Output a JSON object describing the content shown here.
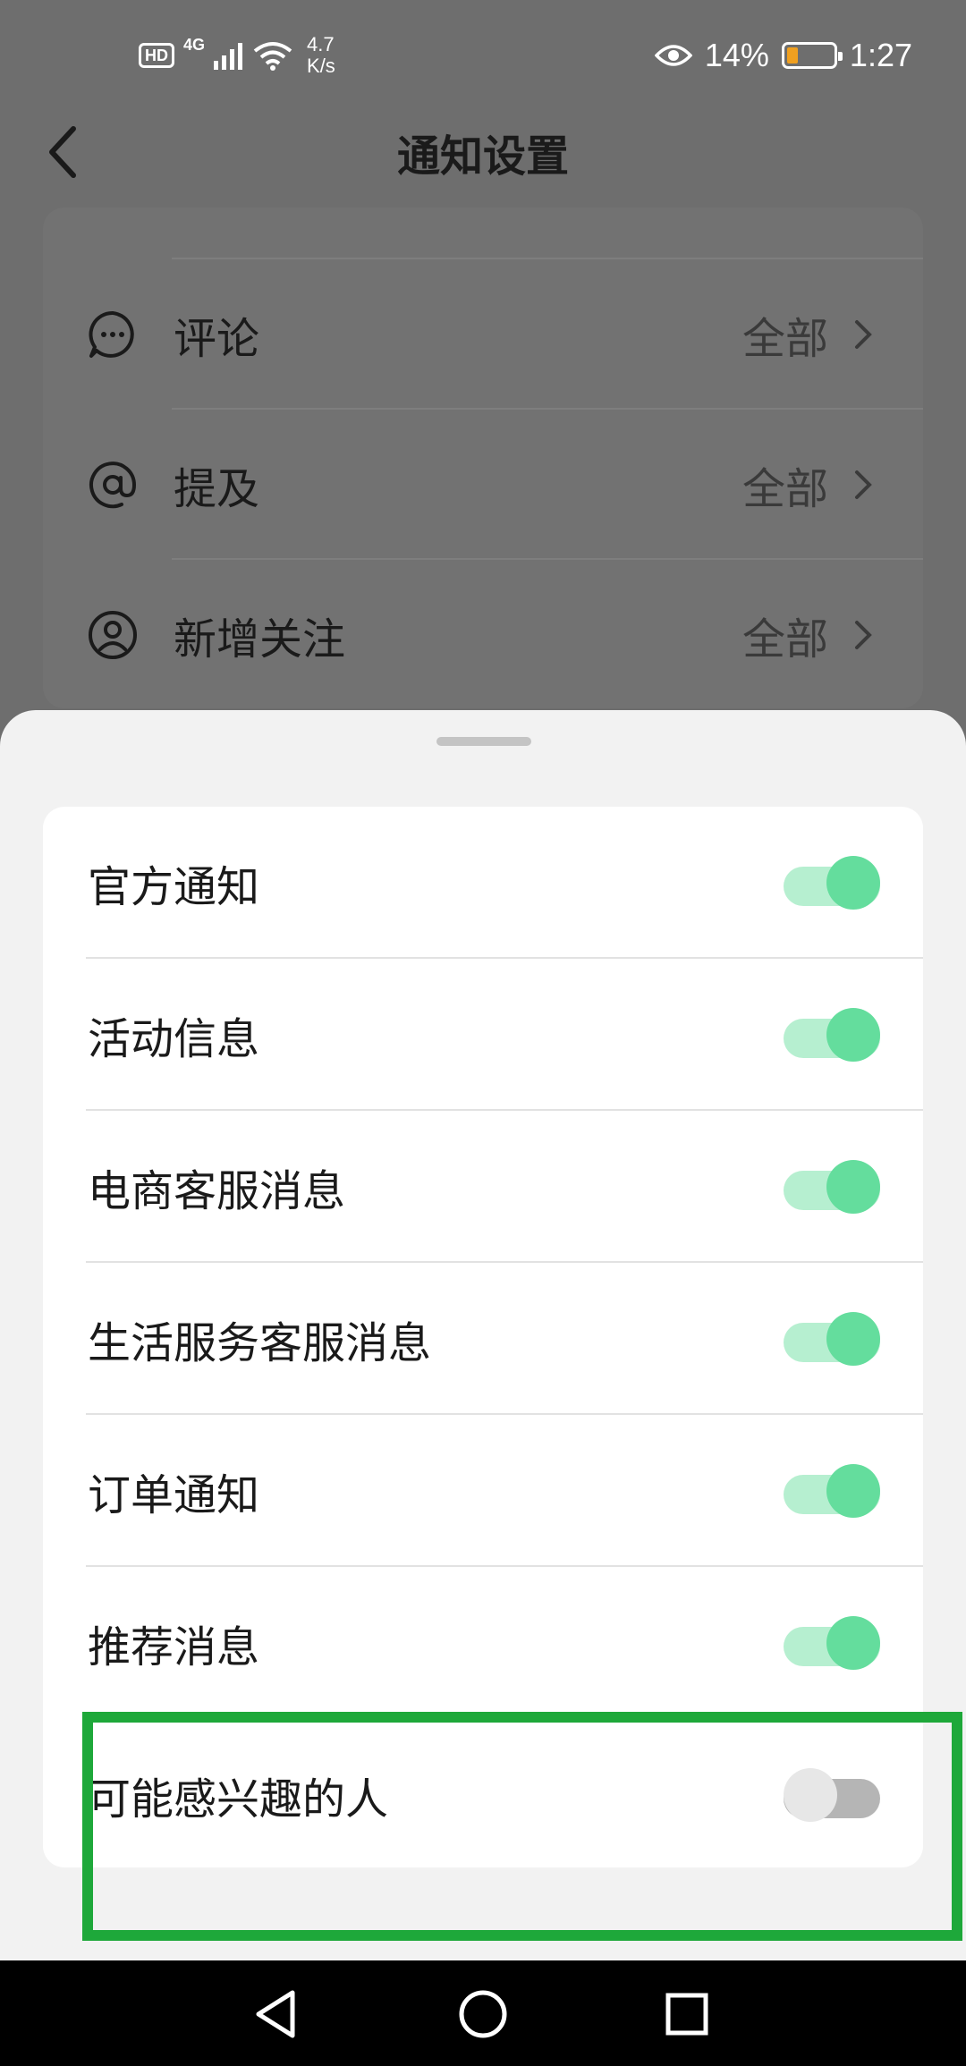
{
  "status_bar": {
    "hd": "HD",
    "network": "4G",
    "speed_value": "4.7",
    "speed_unit": "K/s",
    "battery_percent": "14%",
    "time": "1:27",
    "icons": [
      "signal-icon",
      "wifi-icon",
      "eye-icon",
      "battery-icon"
    ]
  },
  "header": {
    "title": "通知设置",
    "back_icon": "back-chevron-icon"
  },
  "background_list": {
    "items": [
      {
        "icon": "comment-icon",
        "label": "评论",
        "value": "全部"
      },
      {
        "icon": "at-icon",
        "label": "提及",
        "value": "全部"
      },
      {
        "icon": "user-icon",
        "label": "新增关注",
        "value": "全部"
      }
    ]
  },
  "sheet": {
    "options": [
      {
        "label": "官方通知",
        "enabled": true
      },
      {
        "label": "活动信息",
        "enabled": true
      },
      {
        "label": "电商客服消息",
        "enabled": true
      },
      {
        "label": "生活服务客服消息",
        "enabled": true
      },
      {
        "label": "订单通知",
        "enabled": true
      },
      {
        "label": "推荐消息",
        "enabled": true
      },
      {
        "label": "可能感兴趣的人",
        "enabled": false
      }
    ]
  },
  "colors": {
    "toggle_on_knob": "#64dd9d",
    "toggle_on_track": "#b6efd0",
    "toggle_off_knob": "#e7e7e7",
    "toggle_off_track": "#b5b5b5",
    "highlight": "#1ea83a"
  },
  "nav_bar": {
    "buttons": [
      "back-triangle-icon",
      "home-circle-icon",
      "recents-square-icon"
    ]
  }
}
